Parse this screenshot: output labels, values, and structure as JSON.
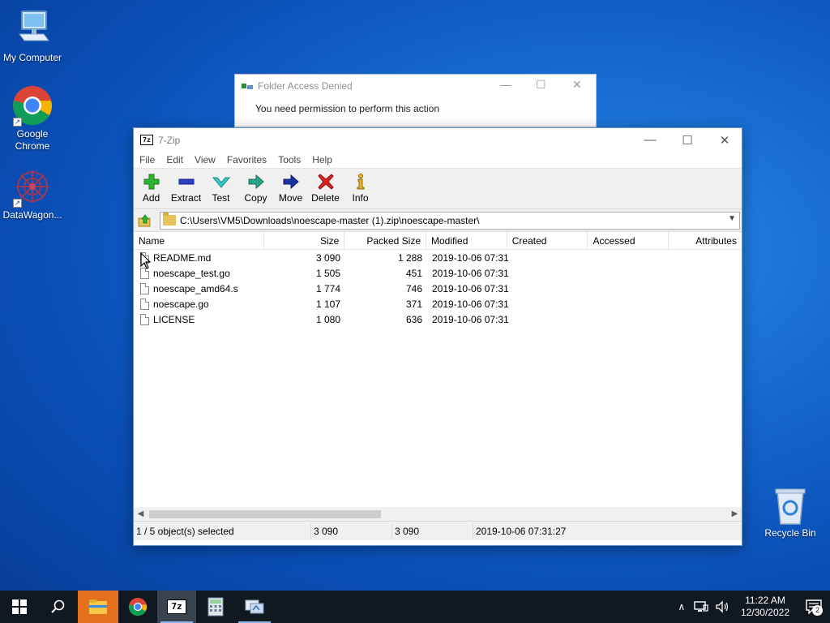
{
  "desktop": {
    "icons": [
      {
        "label": "My Computer"
      },
      {
        "label": "Google Chrome"
      },
      {
        "label": "DataWagon..."
      }
    ],
    "recycle_bin": "Recycle Bin"
  },
  "background_dialog": {
    "title": "Folder Access Denied",
    "message": "You need permission to perform this action"
  },
  "window": {
    "title": "7-Zip",
    "app_icon_text": "7z",
    "menu": [
      "File",
      "Edit",
      "View",
      "Favorites",
      "Tools",
      "Help"
    ],
    "toolbar": [
      {
        "label": "Add",
        "icon": "add-icon"
      },
      {
        "label": "Extract",
        "icon": "extract-icon"
      },
      {
        "label": "Test",
        "icon": "test-icon"
      },
      {
        "label": "Copy",
        "icon": "copy-icon"
      },
      {
        "label": "Move",
        "icon": "move-icon"
      },
      {
        "label": "Delete",
        "icon": "delete-icon"
      },
      {
        "label": "Info",
        "icon": "info-icon"
      }
    ],
    "address": "C:\\Users\\VM5\\Downloads\\noescape-master (1).zip\\noescape-master\\",
    "columns": [
      "Name",
      "Size",
      "Packed Size",
      "Modified",
      "Created",
      "Accessed",
      "Attributes"
    ],
    "files": [
      {
        "name": "README.md",
        "size": "3 090",
        "packed": "1 288",
        "modified": "2019-10-06 07:31"
      },
      {
        "name": "noescape_test.go",
        "size": "1 505",
        "packed": "451",
        "modified": "2019-10-06 07:31"
      },
      {
        "name": "noescape_amd64.s",
        "size": "1 774",
        "packed": "746",
        "modified": "2019-10-06 07:31"
      },
      {
        "name": "noescape.go",
        "size": "1 107",
        "packed": "371",
        "modified": "2019-10-06 07:31"
      },
      {
        "name": "LICENSE",
        "size": "1 080",
        "packed": "636",
        "modified": "2019-10-06 07:31"
      }
    ],
    "status": {
      "selection": "1 / 5 object(s) selected",
      "size": "3 090",
      "packed": "3 090",
      "modified": "2019-10-06 07:31:27"
    }
  },
  "taskbar": {
    "items": [
      "start-icon",
      "search-icon",
      "file-explorer-icon",
      "chrome-icon",
      "7zip-icon",
      "calculator-icon",
      "network-app-icon"
    ],
    "time": "11:22 AM",
    "date": "12/30/2022",
    "notification_count": "2"
  },
  "colors": {
    "desktop_bg": "#1568cf",
    "taskbar_bg": "#101820",
    "explorer_highlight": "#e5701d"
  }
}
